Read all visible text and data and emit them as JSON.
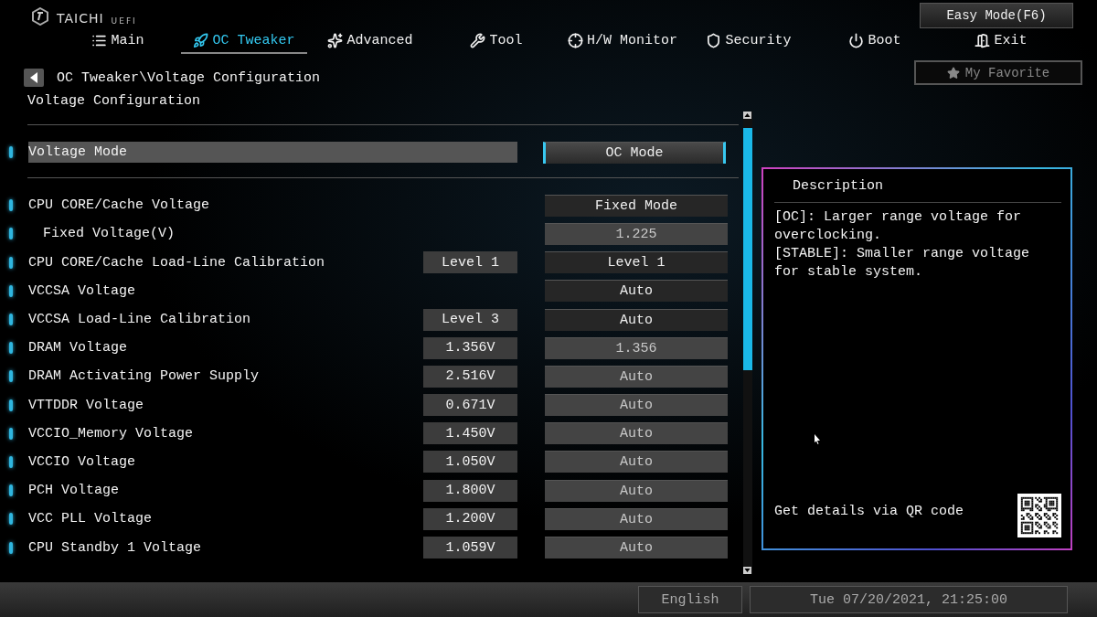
{
  "brand": {
    "name": "TAICHI",
    "suffix": "UEFI"
  },
  "easy_mode_button": "Easy Mode(F6)",
  "tabs": [
    {
      "label": "Main",
      "kind": "main",
      "selected": false
    },
    {
      "label": "OC Tweaker",
      "kind": "oc",
      "selected": true
    },
    {
      "label": "Advanced",
      "kind": "advanced",
      "selected": false
    },
    {
      "label": "Tool",
      "kind": "tool",
      "selected": false
    },
    {
      "label": "H/W Monitor",
      "kind": "monitor",
      "selected": false
    },
    {
      "label": "Security",
      "kind": "security",
      "selected": false
    },
    {
      "label": "Boot",
      "kind": "boot",
      "selected": false
    },
    {
      "label": "Exit",
      "kind": "exit",
      "selected": false
    }
  ],
  "favorite_button": "My Favorite",
  "breadcrumb": "OC Tweaker\\Voltage Configuration",
  "section_title": "Voltage Configuration",
  "mode_setting": {
    "label": "Voltage Mode",
    "value": "OC Mode",
    "selected": true
  },
  "settings": [
    {
      "label": "CPU CORE/Cache Voltage",
      "value": "Fixed Mode",
      "kind": "select",
      "selected": false,
      "children": [
        {
          "label": "Fixed Voltage(V)",
          "value": "1.225",
          "kind": "input",
          "selected": false
        }
      ]
    },
    {
      "label": "CPU CORE/Cache Load-Line Calibration",
      "current": "Level 1",
      "value": "Level 1",
      "kind": "select",
      "selected": false
    },
    {
      "label": "VCCSA Voltage",
      "value": "Auto",
      "kind": "select",
      "selected": false
    },
    {
      "label": "VCCSA Load-Line Calibration",
      "current": "Level 3",
      "value": "Auto",
      "kind": "select",
      "selected": false
    },
    {
      "label": "DRAM Voltage",
      "current": "1.356V",
      "value": "1.356",
      "kind": "input",
      "selected": false
    },
    {
      "label": "DRAM Activating Power Supply",
      "current": "2.516V",
      "value": "Auto",
      "kind": "input",
      "selected": false
    },
    {
      "label": "VTTDDR Voltage",
      "current": "0.671V",
      "value": "Auto",
      "kind": "input",
      "selected": false
    },
    {
      "label": "VCCIO_Memory Voltage",
      "current": "1.450V",
      "value": "Auto",
      "kind": "input",
      "selected": false
    },
    {
      "label": "VCCIO Voltage",
      "current": "1.050V",
      "value": "Auto",
      "kind": "input",
      "selected": false
    },
    {
      "label": "PCH Voltage",
      "current": "1.800V",
      "value": "Auto",
      "kind": "input",
      "selected": false
    },
    {
      "label": "VCC PLL Voltage",
      "current": "1.200V",
      "value": "Auto",
      "kind": "input",
      "selected": false
    },
    {
      "label": "CPU Standby 1 Voltage",
      "current": "1.059V",
      "value": "Auto",
      "kind": "input",
      "selected": false
    }
  ],
  "description": {
    "title": "Description",
    "lines": [
      "[OC]: Larger range voltage for overclocking.",
      "[STABLE]: Smaller range voltage for stable system."
    ],
    "qr_hint": "Get details via QR code"
  },
  "status_bar": {
    "language": "English",
    "datetime": "Tue 07/20/2021, 21:25:00"
  }
}
